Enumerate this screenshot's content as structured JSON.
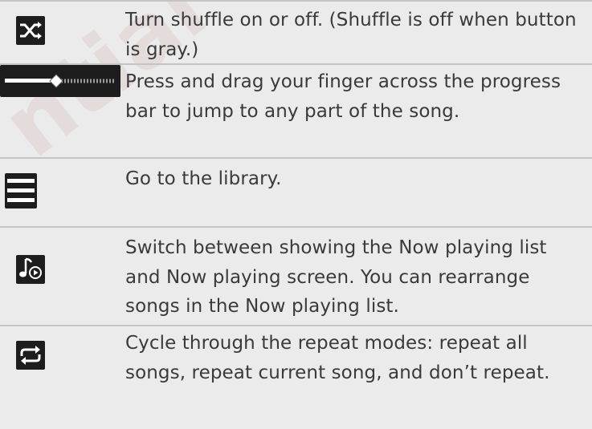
{
  "rows": [
    {
      "icon": "shuffle-icon",
      "text": "Turn shuffle on or off. (Shuffle is off when button is gray.)"
    },
    {
      "icon": "progress-bar-icon",
      "text": "Press and drag your finger across the progress bar to jump to any part of the song."
    },
    {
      "icon": "library-icon",
      "text": "Go to the library."
    },
    {
      "icon": "now-playing-icon",
      "text": "Switch between showing the Now playing list and Now playing screen. You can rearrange songs in the Now playing list."
    },
    {
      "icon": "repeat-icon",
      "text": "Cycle through the repeat modes: repeat all songs, repeat current song, and don’t repeat."
    }
  ],
  "watermark": "ntial Z",
  "colors": {
    "background": "#ebebeb",
    "text": "#3a3a3a",
    "divider": "#c4c4c4",
    "icon_bg": "#1d1d1d"
  }
}
